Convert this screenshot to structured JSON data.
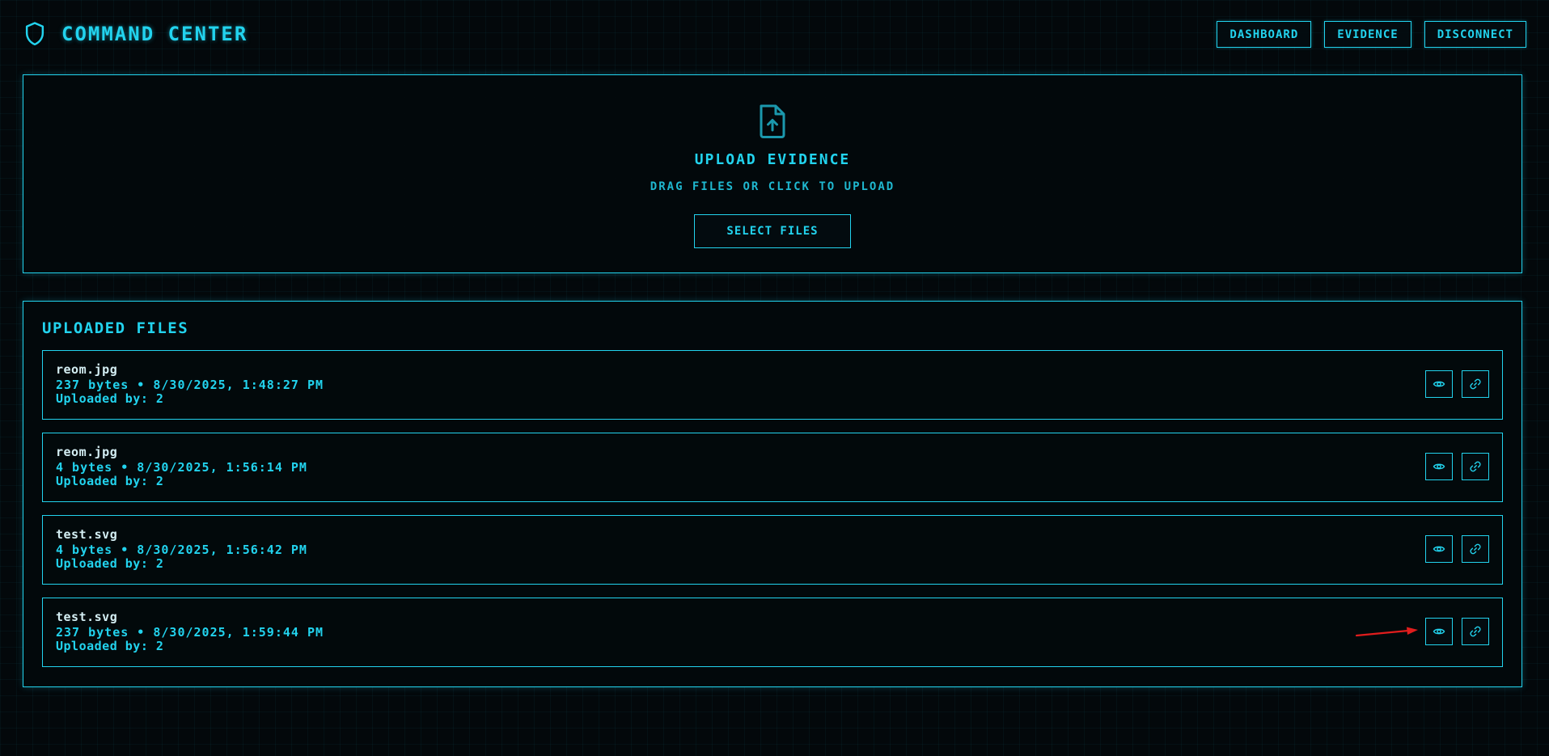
{
  "header": {
    "icon": "shield-icon",
    "title": "COMMAND CENTER",
    "nav": [
      {
        "label": "DASHBOARD"
      },
      {
        "label": "EVIDENCE"
      },
      {
        "label": "DISCONNECT"
      }
    ]
  },
  "upload": {
    "icon": "file-upload-icon",
    "title": "UPLOAD EVIDENCE",
    "subtitle": "DRAG FILES OR CLICK TO UPLOAD",
    "button_label": "SELECT FILES"
  },
  "files": {
    "title": "UPLOADED FILES",
    "items": [
      {
        "name": "reom.jpg",
        "meta": "237 bytes • 8/30/2025, 1:48:27 PM",
        "uploader": "Uploaded by: 2"
      },
      {
        "name": "reom.jpg",
        "meta": "4 bytes • 8/30/2025, 1:56:14 PM",
        "uploader": "Uploaded by: 2"
      },
      {
        "name": "test.svg",
        "meta": "4 bytes • 8/30/2025, 1:56:42 PM",
        "uploader": "Uploaded by: 2"
      },
      {
        "name": "test.svg",
        "meta": "237 bytes • 8/30/2025, 1:59:44 PM",
        "uploader": "Uploaded by: 2"
      }
    ],
    "row_action_icons": [
      "eye-icon",
      "link-icon"
    ]
  },
  "colors": {
    "accent": "#22d3ee",
    "background": "#03080b",
    "annotation": "#e11d1d"
  }
}
